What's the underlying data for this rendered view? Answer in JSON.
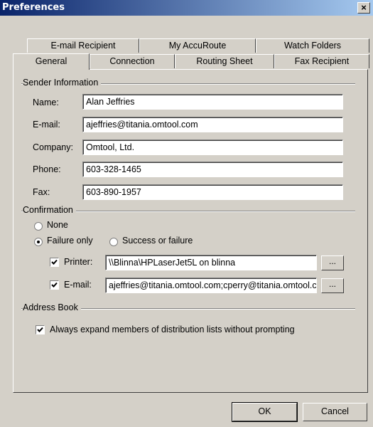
{
  "window": {
    "title": "Preferences",
    "close_glyph": "×"
  },
  "tabs": {
    "row_top": [
      "E-mail Recipient",
      "My AccuRoute",
      "Watch Folders"
    ],
    "row_bottom": [
      "General",
      "Connection",
      "Routing Sheet",
      "Fax Recipient"
    ],
    "selected": "General"
  },
  "sender": {
    "heading": "Sender Information",
    "name_label": "Name:",
    "name_value": "Alan Jeffries",
    "email_label": "E-mail:",
    "email_value": "ajeffries@titania.omtool.com",
    "company_label": "Company:",
    "company_value": "Omtool, Ltd.",
    "phone_label": "Phone:",
    "phone_value": "603-328-1465",
    "fax_label": "Fax:",
    "fax_value": "603-890-1957"
  },
  "confirmation": {
    "heading": "Confirmation",
    "none_label": "None",
    "failure_label": "Failure only",
    "success_label": "Success or failure",
    "selected": "Failure only",
    "printer_label": "Printer:",
    "printer_checked": true,
    "printer_value": "\\\\Blinna\\HPLaserJet5L on blinna",
    "email_label": "E-mail:",
    "email_checked": true,
    "email_value": "ajeffries@titania.omtool.com;cperry@titania.omtool.com",
    "browse_label": "..."
  },
  "address_book": {
    "heading": "Address Book",
    "expand_label": "Always expand members of distribution lists without prompting",
    "expand_checked": true
  },
  "buttons": {
    "ok": "OK",
    "cancel": "Cancel"
  }
}
